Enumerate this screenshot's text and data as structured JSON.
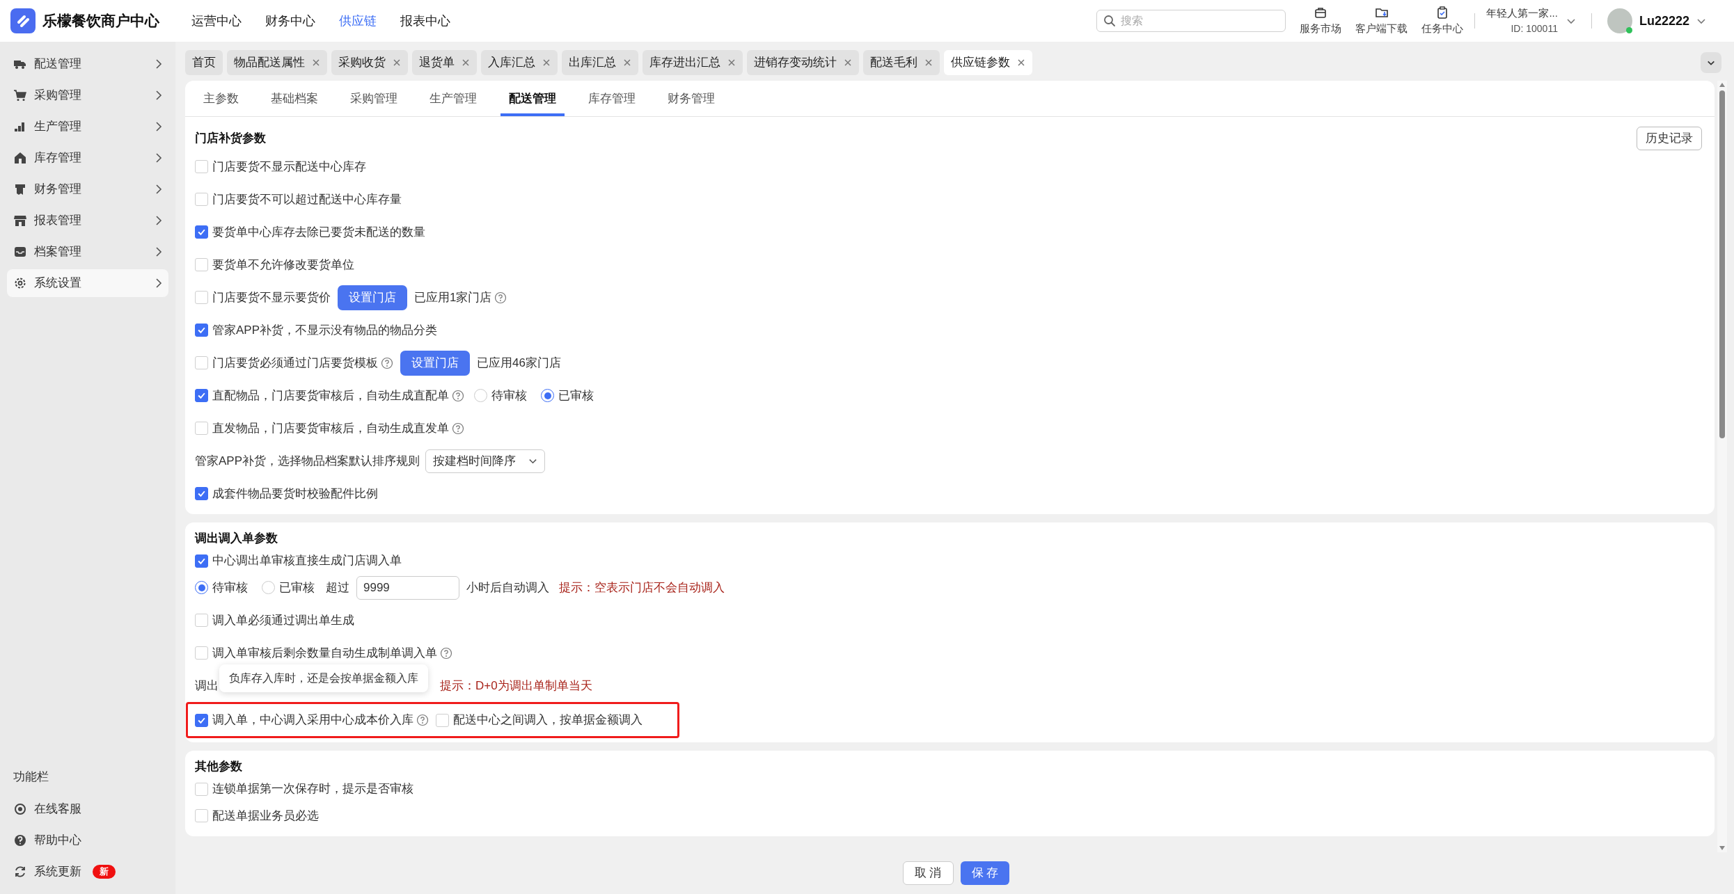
{
  "app": {
    "title": "乐檬餐饮商户中心"
  },
  "nav": [
    {
      "label": "运营中心",
      "selected": false
    },
    {
      "label": "财务中心",
      "selected": false
    },
    {
      "label": "供应链",
      "selected": true
    },
    {
      "label": "报表中心",
      "selected": false
    }
  ],
  "search": {
    "placeholder": "搜索"
  },
  "header_tools": [
    {
      "label": "服务市场"
    },
    {
      "label": "客户端下载"
    },
    {
      "label": "任务中心"
    }
  ],
  "store": {
    "name": "年轻人第一家...",
    "id": "ID: 100011"
  },
  "user": {
    "name": "Lu22222"
  },
  "sidebar": {
    "items": [
      {
        "label": "配送管理",
        "selected": false
      },
      {
        "label": "采购管理",
        "selected": false
      },
      {
        "label": "生产管理",
        "selected": false
      },
      {
        "label": "库存管理",
        "selected": false
      },
      {
        "label": "财务管理",
        "selected": false
      },
      {
        "label": "报表管理",
        "selected": false
      },
      {
        "label": "档案管理",
        "selected": false
      },
      {
        "label": "系统设置",
        "selected": true
      }
    ],
    "section_title": "功能栏",
    "tools": [
      {
        "label": "在线客服"
      },
      {
        "label": "帮助中心"
      },
      {
        "label": "系统更新",
        "badge": "新"
      }
    ]
  },
  "page_tabs": [
    {
      "label": "首页",
      "closable": false,
      "selected": false
    },
    {
      "label": "物品配送属性",
      "closable": true,
      "selected": false
    },
    {
      "label": "采购收货",
      "closable": true,
      "selected": false
    },
    {
      "label": "退货单",
      "closable": true,
      "selected": false
    },
    {
      "label": "入库汇总",
      "closable": true,
      "selected": false
    },
    {
      "label": "出库汇总",
      "closable": true,
      "selected": false
    },
    {
      "label": "库存进出汇总",
      "closable": true,
      "selected": false
    },
    {
      "label": "进销存变动统计",
      "closable": true,
      "selected": false
    },
    {
      "label": "配送毛利",
      "closable": true,
      "selected": false
    },
    {
      "label": "供应链参数",
      "closable": true,
      "selected": true
    }
  ],
  "sub_tabs": [
    {
      "label": "主参数",
      "selected": false
    },
    {
      "label": "基础档案",
      "selected": false
    },
    {
      "label": "采购管理",
      "selected": false
    },
    {
      "label": "生产管理",
      "selected": false
    },
    {
      "label": "配送管理",
      "selected": true
    },
    {
      "label": "库存管理",
      "selected": false
    },
    {
      "label": "财务管理",
      "selected": false
    }
  ],
  "sections": [
    {
      "title": "门店补货参数",
      "action": "历史记录",
      "rows": [
        {
          "items": [
            {
              "kind": "checkbox",
              "label": "门店要货不显示配送中心库存",
              "checked": false
            }
          ]
        },
        {
          "items": [
            {
              "kind": "checkbox",
              "label": "门店要货不可以超过配送中心库存量",
              "checked": false
            }
          ]
        },
        {
          "items": [
            {
              "kind": "checkbox",
              "label": "要货单中心库存去除已要货未配送的数量",
              "checked": true
            }
          ]
        },
        {
          "items": [
            {
              "kind": "checkbox",
              "label": "要货单不允许修改要货单位",
              "checked": false
            }
          ]
        },
        {
          "items": [
            {
              "kind": "checkbox",
              "label": "门店要货不显示要货价",
              "checked": false
            },
            {
              "kind": "button",
              "label": "设置门店"
            },
            {
              "kind": "note",
              "label": "已应用1家门店",
              "help": true
            }
          ]
        },
        {
          "items": [
            {
              "kind": "checkbox",
              "label": "管家APP补货，不显示没有物品的物品分类",
              "checked": true
            }
          ]
        },
        {
          "items": [
            {
              "kind": "checkbox",
              "label": "门店要货必须通过门店要货模板",
              "checked": false,
              "help": true
            },
            {
              "kind": "button",
              "label": "设置门店"
            },
            {
              "kind": "note",
              "label": "已应用46家门店"
            }
          ]
        },
        {
          "items": [
            {
              "kind": "checkbox",
              "label": "直配物品，门店要货审核后，自动生成直配单",
              "checked": true,
              "help": true
            },
            {
              "kind": "radio",
              "label": "待审核",
              "selected": false
            },
            {
              "kind": "radio",
              "label": "已审核",
              "selected": true
            }
          ]
        },
        {
          "items": [
            {
              "kind": "checkbox",
              "label": "直发物品，门店要货审核后，自动生成直发单",
              "checked": false,
              "help": true
            }
          ]
        },
        {
          "items": [
            {
              "kind": "note",
              "label": "管家APP补货，选择物品档案默认排序规则"
            },
            {
              "kind": "select",
              "value": "按建档时间降序"
            }
          ]
        },
        {
          "items": [
            {
              "kind": "checkbox",
              "label": "成套件物品要货时校验配件比例",
              "checked": true
            }
          ]
        }
      ]
    },
    {
      "title": "调出调入单参数",
      "rows": [
        {
          "items": [
            {
              "kind": "checkbox",
              "label": "中心调出单审核直接生成门店调入单",
              "checked": true
            }
          ]
        },
        {
          "items": [
            {
              "kind": "radio",
              "label": "待审核",
              "selected": true
            },
            {
              "kind": "radio",
              "label": "已审核",
              "selected": false
            },
            {
              "kind": "note",
              "label": "超过"
            },
            {
              "kind": "input",
              "value": "9999"
            },
            {
              "kind": "note",
              "label": "小时后自动调入"
            },
            {
              "kind": "hint",
              "label": "提示：空表示门店不会自动调入"
            }
          ]
        },
        {
          "items": [
            {
              "kind": "checkbox",
              "label": "调入单必须通过调出单生成",
              "checked": false
            }
          ]
        },
        {
          "items": [
            {
              "kind": "checkbox",
              "label": "调入单审核后剩余数量自动生成制单调入单",
              "checked": false,
              "help": true
            }
          ]
        },
        {
          "items": [
            {
              "kind": "note",
              "label": "调出"
            },
            {
              "kind": "tooltip",
              "label": "负库存入库时，还是会按单据金额入库"
            },
            {
              "kind": "hint",
              "label": "提示：D+0为调出单制单当天"
            }
          ]
        },
        {
          "highlighted": true,
          "items": [
            {
              "kind": "checkbox",
              "label": "调入单，中心调入采用中心成本价入库",
              "checked": true,
              "help": true
            },
            {
              "kind": "checkbox",
              "label": "配送中心之间调入，按单据金额调入",
              "checked": false
            }
          ]
        }
      ]
    },
    {
      "title": "其他参数",
      "rows": [
        {
          "items": [
            {
              "kind": "checkbox",
              "label": "连锁单据第一次保存时，提示是否审核",
              "checked": false
            }
          ]
        },
        {
          "items": [
            {
              "kind": "checkbox",
              "label": "配送单据业务员必选",
              "checked": false
            }
          ]
        }
      ]
    }
  ],
  "footer": {
    "cancel": "取 消",
    "save": "保 存"
  }
}
